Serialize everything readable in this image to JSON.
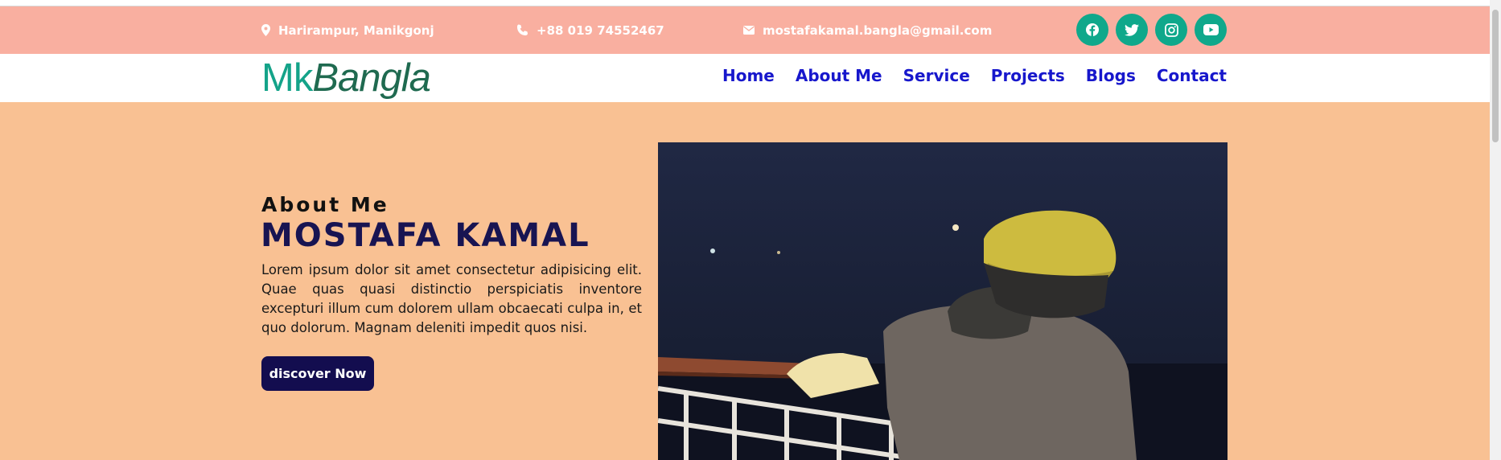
{
  "topbar": {
    "address": "Harirampur, Manikgonj",
    "phone": "+88 019 74552467",
    "email": "mostafakamal.bangla@gmail.com",
    "social": [
      "facebook-icon",
      "twitter-icon",
      "instagram-icon",
      "youtube-icon"
    ]
  },
  "brand": {
    "part1": "Mk",
    "part2": "Bangla"
  },
  "nav": {
    "items": [
      "Home",
      "About Me",
      "Service",
      "Projects",
      "Blogs",
      "Contact"
    ]
  },
  "hero": {
    "eyebrow": "About Me",
    "name": "MOSTAFA KAMAL",
    "description": "Lorem ipsum dolor sit amet consectetur adipisicing elit. Quae quas quasi distinctio perspiciatis inventore excepturi illum cum dolorem ullam obcaecati culpa in, et quo dolorum. Magnam deleniti impedit quos nisi.",
    "button": "discover Now"
  },
  "colors": {
    "topbar": "#f9afa0",
    "hero": "#f9c193",
    "social": "#0fa88b",
    "nav_link": "#1717cc",
    "heading": "#181452",
    "button": "#130d4f"
  }
}
